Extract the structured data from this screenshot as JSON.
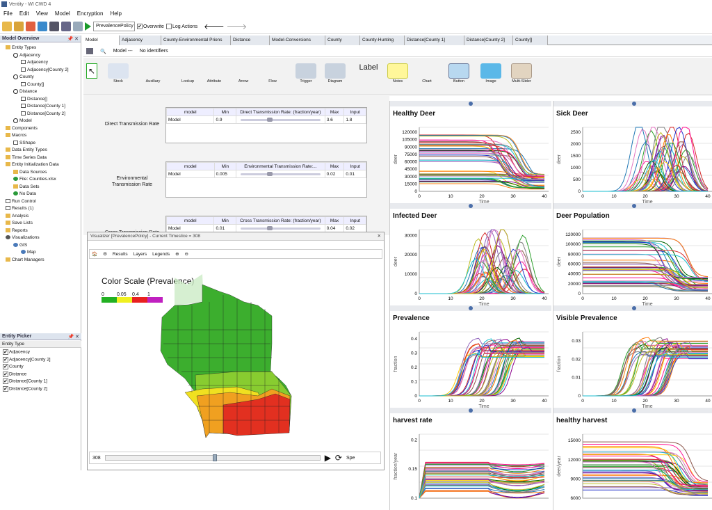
{
  "app": {
    "title": "Ventity - WI CWD 4"
  },
  "menu": [
    "File",
    "Edit",
    "View",
    "Model",
    "Encryption",
    "Help"
  ],
  "toolbar": {
    "policy_value": "PrevalencePolicy",
    "overwrite_label": "Overwrite",
    "log_actions_label": "Log Actions"
  },
  "left": {
    "overview_title": "Model Overview",
    "tree": [
      {
        "label": "Entity Types",
        "icon": "folder",
        "depth": 0
      },
      {
        "label": "Adjacency",
        "icon": "entity",
        "depth": 1
      },
      {
        "label": "Adjacency",
        "icon": "box",
        "depth": 2
      },
      {
        "label": "Adjacency[County 2]",
        "icon": "box",
        "depth": 2
      },
      {
        "label": "County",
        "icon": "entity",
        "depth": 1
      },
      {
        "label": "County[]",
        "icon": "box",
        "depth": 2
      },
      {
        "label": "Distance",
        "icon": "entity",
        "depth": 1
      },
      {
        "label": "Distance[]",
        "icon": "box",
        "depth": 2
      },
      {
        "label": "Distance[County 1]",
        "icon": "box",
        "depth": 2
      },
      {
        "label": "Distance[County 2]",
        "icon": "box",
        "depth": 2
      },
      {
        "label": "Model",
        "icon": "entity",
        "depth": 1
      },
      {
        "label": "Components",
        "icon": "folder",
        "depth": 0
      },
      {
        "label": "Macros",
        "icon": "folder",
        "depth": 0
      },
      {
        "label": "SShape",
        "icon": "box",
        "depth": 1
      },
      {
        "label": "Data Entity Types",
        "icon": "folder",
        "depth": 0
      },
      {
        "label": "Time Series Data",
        "icon": "folder",
        "depth": 0
      },
      {
        "label": "Entity Initialization Data",
        "icon": "folder",
        "depth": 0
      },
      {
        "label": "Data Sources",
        "icon": "folder",
        "depth": 1
      },
      {
        "label": "File: Counties.xlsx",
        "icon": "file",
        "depth": 1
      },
      {
        "label": "Data Sets",
        "icon": "folder",
        "depth": 1
      },
      {
        "label": "No Data",
        "icon": "file",
        "depth": 1
      },
      {
        "label": "Run Control",
        "icon": "box",
        "depth": 0
      },
      {
        "label": "Results (1)",
        "icon": "box",
        "depth": 0
      },
      {
        "label": "Analysis",
        "icon": "folder",
        "depth": 0
      },
      {
        "label": "Save Lists",
        "icon": "folder",
        "depth": 0
      },
      {
        "label": "Reports",
        "icon": "folder",
        "depth": 0
      },
      {
        "label": "Visualizations",
        "icon": "eye",
        "depth": 0
      },
      {
        "label": "GIS",
        "icon": "globe",
        "depth": 1
      },
      {
        "label": "Map",
        "icon": "globe",
        "depth": 2
      },
      {
        "label": "Chart Managers",
        "icon": "folder",
        "depth": 0
      }
    ],
    "picker_title": "Entity Picker",
    "picker_header": "Entity Type",
    "picker_items": [
      "Adjacency",
      "Adjacency[County 2]",
      "County",
      "Distance",
      "Distance[County 1]",
      "Distance[County 2]"
    ]
  },
  "tabs": [
    "Model",
    "Adjacency",
    "County-Environmental Prions",
    "Distance",
    "Model-Conversions",
    "County",
    "County-Hunting",
    "Distance[County 1]",
    "Distance[County 2]",
    "County[]"
  ],
  "subbar": {
    "model_label": "Model ---",
    "identifiers": "No identifiers"
  },
  "palette": [
    "Stock",
    "Auxiliary",
    "Lookup",
    "Attribute",
    "Arrow",
    "Flow",
    "Trigger",
    "Diagram",
    "Label",
    "Notes",
    "Chart",
    "Button",
    "Image",
    "Multi-Slider"
  ],
  "params": [
    {
      "label": "Direct Transmission Rate",
      "entity": "Model",
      "min": "0.9",
      "slider": "Direct Transmission Rate:  (fraction/year)",
      "max": "3.6",
      "input": "1.8",
      "pos": 0.33
    },
    {
      "label": "Environmental Transmission Rate",
      "entity": "Model",
      "min": "0.005",
      "slider": "Environmental Transmission Rate:...",
      "max": "0.02",
      "input": "0.01",
      "pos": 0.33
    },
    {
      "label": "Cross Transmission Rate",
      "entity": "Model",
      "min": "0.01",
      "slider": "Cross Transmission Rate:  (fraction/year)",
      "max": "0.04",
      "input": "0.02",
      "pos": 0.33
    }
  ],
  "param_headers": {
    "model": "model",
    "min": "Min",
    "max": "Max",
    "input": "Input"
  },
  "visualizer": {
    "title": "Visualizer [PrevalencePolicy]  - Current Timeslice = 308",
    "menus": [
      "Results",
      "Layers",
      "Legends"
    ],
    "scale_title": "Color Scale (Prevalence)",
    "scale_ticks": [
      "0",
      "0.05",
      "0.4",
      "1"
    ],
    "scale_colors": [
      "#22b022",
      "#f0f020",
      "#e82020",
      "#c020c0"
    ],
    "timeslice": "308",
    "speed_label": "Spe",
    "slider_fraction": 0.5
  },
  "charts": [
    {
      "title": "Healthy Deer",
      "ylabel": "deer",
      "xlabel": "Time",
      "yticks": [
        "0",
        "30000",
        "60000",
        "90000",
        "120000",
        "15000",
        "45000",
        "75000",
        "105000"
      ],
      "ymax": 130000,
      "xticks": [
        "0",
        "10",
        "20",
        "30",
        "40"
      ],
      "kind": "decline"
    },
    {
      "title": "Sick Deer",
      "ylabel": "deer",
      "xlabel": "Time",
      "yticks": [
        "0",
        "500",
        "1000",
        "1500",
        "2000",
        "2500"
      ],
      "ymax": 2700,
      "xticks": [
        "0",
        "10",
        "20",
        "30",
        "40"
      ],
      "kind": "rise"
    },
    {
      "title": "Infected Deer",
      "ylabel": "deer",
      "xlabel": "Time",
      "yticks": [
        "0",
        "10000",
        "20000",
        "30000"
      ],
      "ymax": 33000,
      "xticks": [
        "0",
        "10",
        "20",
        "30",
        "40"
      ],
      "kind": "rise"
    },
    {
      "title": "Deer Population",
      "ylabel": "deer",
      "xlabel": "Time",
      "yticks": [
        "0",
        "20000",
        "40000",
        "60000",
        "80000",
        "100000",
        "120000"
      ],
      "ymax": 130000,
      "xticks": [
        "0",
        "10",
        "20",
        "30",
        "40"
      ],
      "kind": "decline"
    },
    {
      "title": "Prevalence",
      "ylabel": "fraction",
      "xlabel": "Time",
      "yticks": [
        "0",
        "0.1",
        "0.2",
        "0.3",
        "0.4"
      ],
      "ymax": 0.45,
      "xticks": [
        "0",
        "10",
        "20",
        "30",
        "40"
      ],
      "kind": "sigmoid"
    },
    {
      "title": "Visible Prevalence",
      "ylabel": "fraction",
      "xlabel": "Time",
      "yticks": [
        "0",
        "0.01",
        "0.02",
        "0.03"
      ],
      "ymax": 0.035,
      "xticks": [
        "0",
        "10",
        "20",
        "30",
        "40"
      ],
      "kind": "sigmoid"
    },
    {
      "title": "harvest rate",
      "ylabel": "fraction/year",
      "xlabel": "",
      "yticks": [
        "0.1",
        "0.15",
        "0.2"
      ],
      "ymax": 0.21,
      "xticks": [],
      "kind": "flat"
    },
    {
      "title": "healthy harvest",
      "ylabel": "deer/year",
      "xlabel": "",
      "yticks": [
        "6000",
        "9000",
        "12000",
        "15000"
      ],
      "ymax": 16000,
      "xticks": [],
      "kind": "decline"
    }
  ]
}
